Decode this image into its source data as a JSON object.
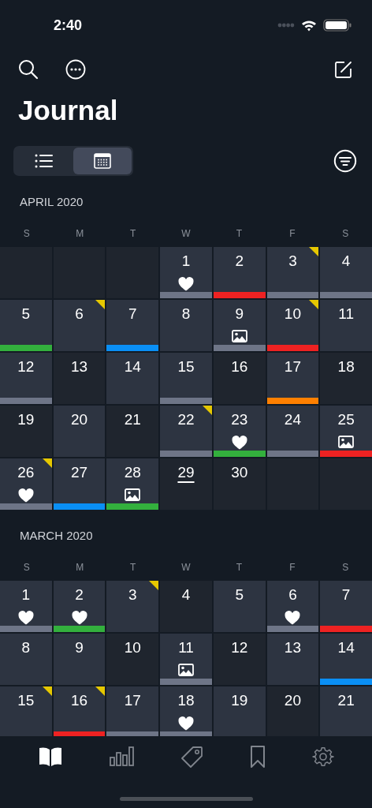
{
  "status_bar": {
    "time": "2:40"
  },
  "title": "Journal",
  "view_switch": [
    {
      "kind": "list",
      "selected": false
    },
    {
      "kind": "calendar",
      "selected": true
    }
  ],
  "months": [
    {
      "label": "APRIL 2020",
      "weekdays": [
        "S",
        "M",
        "T",
        "W",
        "T",
        "F",
        "S"
      ],
      "cells": [
        {
          "kind": "blank"
        },
        {
          "kind": "blank"
        },
        {
          "kind": "blank"
        },
        {
          "kind": "day",
          "day": "1",
          "entry": true,
          "flag": false,
          "today": false,
          "attachments": [
            {
              "kind": "heart"
            }
          ],
          "color": "#6e7587"
        },
        {
          "kind": "day",
          "day": "2",
          "entry": true,
          "flag": false,
          "today": false,
          "color": "#ee2222"
        },
        {
          "kind": "day",
          "day": "3",
          "entry": true,
          "flag": true,
          "today": false,
          "color": "#6e7587"
        },
        {
          "kind": "day",
          "day": "4",
          "entry": true,
          "flag": false,
          "today": false,
          "color": "#6e7587"
        },
        {
          "kind": "day",
          "day": "5",
          "entry": true,
          "flag": false,
          "today": false,
          "color": "#33b03d"
        },
        {
          "kind": "day",
          "day": "6",
          "entry": true,
          "flag": true,
          "today": false
        },
        {
          "kind": "day",
          "day": "7",
          "entry": true,
          "flag": false,
          "today": false,
          "color": "#0a8ff5"
        },
        {
          "kind": "day",
          "day": "8",
          "entry": true,
          "flag": false,
          "today": false
        },
        {
          "kind": "day",
          "day": "9",
          "entry": true,
          "flag": false,
          "today": false,
          "attachments": [
            {
              "kind": "photo"
            }
          ],
          "color": "#6e7587"
        },
        {
          "kind": "day",
          "day": "10",
          "entry": true,
          "flag": true,
          "today": false,
          "color": "#ee2222"
        },
        {
          "kind": "day",
          "day": "11",
          "entry": true,
          "flag": false,
          "today": false
        },
        {
          "kind": "day",
          "day": "12",
          "entry": true,
          "flag": false,
          "today": false,
          "color": "#6e7587"
        },
        {
          "kind": "day",
          "day": "13",
          "entry": false,
          "flag": false,
          "today": false
        },
        {
          "kind": "day",
          "day": "14",
          "entry": true,
          "flag": false,
          "today": false
        },
        {
          "kind": "day",
          "day": "15",
          "entry": true,
          "flag": false,
          "today": false,
          "color": "#6e7587"
        },
        {
          "kind": "day",
          "day": "16",
          "entry": false,
          "flag": false,
          "today": false
        },
        {
          "kind": "day",
          "day": "17",
          "entry": true,
          "flag": false,
          "today": false,
          "color": "#ff8000"
        },
        {
          "kind": "day",
          "day": "18",
          "entry": false,
          "flag": false,
          "today": false
        },
        {
          "kind": "day",
          "day": "19",
          "entry": false,
          "flag": false,
          "today": false
        },
        {
          "kind": "day",
          "day": "20",
          "entry": true,
          "flag": false,
          "today": false
        },
        {
          "kind": "day",
          "day": "21",
          "entry": false,
          "flag": false,
          "today": false
        },
        {
          "kind": "day",
          "day": "22",
          "entry": true,
          "flag": true,
          "today": false,
          "color": "#6e7587"
        },
        {
          "kind": "day",
          "day": "23",
          "entry": true,
          "flag": false,
          "today": false,
          "attachments": [
            {
              "kind": "heart"
            }
          ],
          "color": "#33b03d"
        },
        {
          "kind": "day",
          "day": "24",
          "entry": true,
          "flag": false,
          "today": false,
          "color": "#6e7587"
        },
        {
          "kind": "day",
          "day": "25",
          "entry": true,
          "flag": false,
          "today": false,
          "attachments": [
            {
              "kind": "photo"
            }
          ],
          "color": "#ee2222"
        },
        {
          "kind": "day",
          "day": "26",
          "entry": true,
          "flag": true,
          "today": false,
          "attachments": [
            {
              "kind": "heart"
            }
          ],
          "color": "#6e7587"
        },
        {
          "kind": "day",
          "day": "27",
          "entry": true,
          "flag": false,
          "today": false,
          "color": "#0a8ff5"
        },
        {
          "kind": "day",
          "day": "28",
          "entry": true,
          "flag": false,
          "today": false,
          "attachments": [
            {
              "kind": "photo"
            }
          ],
          "color": "#33b03d"
        },
        {
          "kind": "day",
          "day": "29",
          "entry": false,
          "flag": false,
          "today": true
        },
        {
          "kind": "day",
          "day": "30",
          "entry": false,
          "flag": false,
          "today": false
        },
        {
          "kind": "blank"
        },
        {
          "kind": "blank"
        }
      ]
    },
    {
      "label": "MARCH 2020",
      "weekdays": [
        "S",
        "M",
        "T",
        "W",
        "T",
        "F",
        "S"
      ],
      "cells": [
        {
          "kind": "day",
          "day": "1",
          "entry": true,
          "flag": false,
          "today": false,
          "attachments": [
            {
              "kind": "heart"
            }
          ],
          "color": "#6e7587"
        },
        {
          "kind": "day",
          "day": "2",
          "entry": true,
          "flag": false,
          "today": false,
          "attachments": [
            {
              "kind": "heart"
            }
          ],
          "color": "#33b03d"
        },
        {
          "kind": "day",
          "day": "3",
          "entry": true,
          "flag": true,
          "today": false
        },
        {
          "kind": "day",
          "day": "4",
          "entry": false,
          "flag": false,
          "today": false
        },
        {
          "kind": "day",
          "day": "5",
          "entry": true,
          "flag": false,
          "today": false
        },
        {
          "kind": "day",
          "day": "6",
          "entry": true,
          "flag": false,
          "today": false,
          "attachments": [
            {
              "kind": "heart"
            }
          ],
          "color": "#6e7587"
        },
        {
          "kind": "day",
          "day": "7",
          "entry": true,
          "flag": false,
          "today": false,
          "color": "#ee2222"
        },
        {
          "kind": "day",
          "day": "8",
          "entry": true,
          "flag": false,
          "today": false
        },
        {
          "kind": "day",
          "day": "9",
          "entry": true,
          "flag": false,
          "today": false
        },
        {
          "kind": "day",
          "day": "10",
          "entry": false,
          "flag": false,
          "today": false
        },
        {
          "kind": "day",
          "day": "11",
          "entry": true,
          "flag": false,
          "today": false,
          "attachments": [
            {
              "kind": "photo"
            }
          ],
          "color": "#6e7587"
        },
        {
          "kind": "day",
          "day": "12",
          "entry": false,
          "flag": false,
          "today": false
        },
        {
          "kind": "day",
          "day": "13",
          "entry": true,
          "flag": false,
          "today": false
        },
        {
          "kind": "day",
          "day": "14",
          "entry": true,
          "flag": false,
          "today": false,
          "color": "#0a8ff5"
        },
        {
          "kind": "day",
          "day": "15",
          "entry": true,
          "flag": true,
          "today": false
        },
        {
          "kind": "day",
          "day": "16",
          "entry": true,
          "flag": true,
          "today": false,
          "color": "#ee2222"
        },
        {
          "kind": "day",
          "day": "17",
          "entry": true,
          "flag": false,
          "today": false,
          "color": "#6e7587"
        },
        {
          "kind": "day",
          "day": "18",
          "entry": true,
          "flag": false,
          "today": false,
          "attachments": [
            {
              "kind": "heart"
            }
          ],
          "color": "#6e7587"
        },
        {
          "kind": "day",
          "day": "19",
          "entry": true,
          "flag": false,
          "today": false
        },
        {
          "kind": "day",
          "day": "20",
          "entry": false,
          "flag": false,
          "today": false
        },
        {
          "kind": "day",
          "day": "21",
          "entry": true,
          "flag": false,
          "today": false
        }
      ]
    }
  ],
  "tabs": [
    {
      "kind": "journal",
      "selected": true
    },
    {
      "kind": "stats",
      "selected": false
    },
    {
      "kind": "tags",
      "selected": false
    },
    {
      "kind": "bookmarks",
      "selected": false
    },
    {
      "kind": "settings",
      "selected": false
    }
  ]
}
